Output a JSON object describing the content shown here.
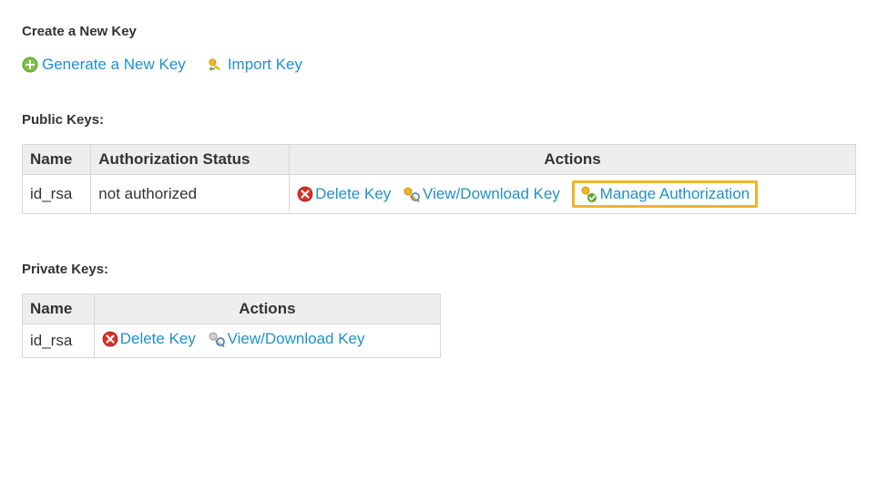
{
  "create": {
    "heading": "Create a New Key",
    "generate_label": "Generate a New Key",
    "import_label": "Import Key"
  },
  "public_keys": {
    "heading": "Public Keys:",
    "columns": {
      "name": "Name",
      "status": "Authorization Status",
      "actions": "Actions"
    },
    "rows": [
      {
        "name": "id_rsa",
        "status": "not authorized",
        "delete_label": "Delete Key",
        "view_label": "View/Download Key",
        "manage_label": "Manage Authorization"
      }
    ]
  },
  "private_keys": {
    "heading": "Private Keys:",
    "columns": {
      "name": "Name",
      "actions": "Actions"
    },
    "rows": [
      {
        "name": "id_rsa",
        "delete_label": "Delete Key",
        "view_label": "View/Download Key"
      }
    ]
  }
}
